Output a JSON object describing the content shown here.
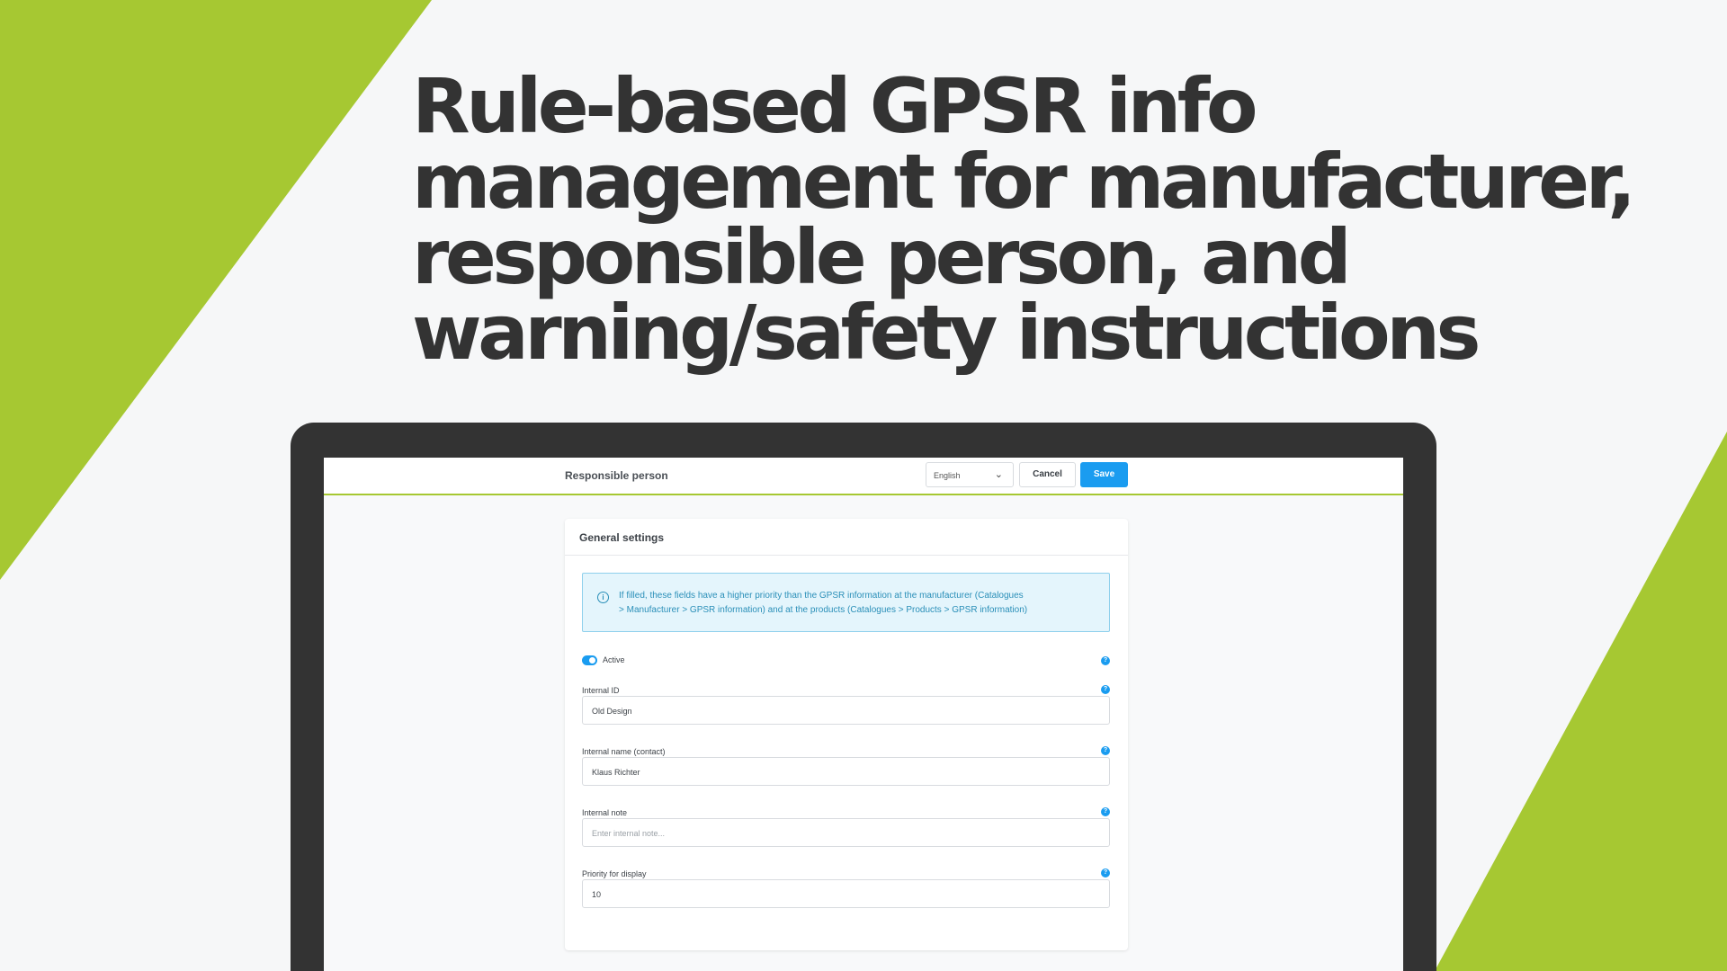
{
  "headline": {
    "line1": "Rule-based GPSR info",
    "line2": "management for manufacturer,",
    "line3": "responsible person, and",
    "line4": "warning/safety instructions"
  },
  "colors": {
    "accent_green": "#a6c832",
    "text_dark": "#333333",
    "primary_blue": "#1a9cf0",
    "info_blue": "#2a8fb8"
  },
  "app": {
    "page_title": "Responsible person",
    "language_select": {
      "selected": "English"
    },
    "cancel_label": "Cancel",
    "save_label": "Save"
  },
  "card": {
    "title": "General settings",
    "alert": {
      "line1": "If filled, these fields have a higher priority than the GPSR information at the manufacturer (Catalogues",
      "line2": "> Manufacturer > GPSR information) and at the products (Catalogues > Products > GPSR information)"
    },
    "active": {
      "label": "Active",
      "checked": true
    },
    "fields": [
      {
        "label": "Internal ID",
        "value": "Old Design",
        "placeholder": ""
      },
      {
        "label": "Internal name (contact)",
        "value": "Klaus Richter",
        "placeholder": ""
      },
      {
        "label": "Internal note",
        "value": "",
        "placeholder": "Enter internal note..."
      },
      {
        "label": "Priority for display",
        "value": "10",
        "placeholder": ""
      }
    ]
  },
  "icons": {
    "info": "info-icon",
    "help": "help-icon",
    "chevron": "chevron-down-icon"
  }
}
